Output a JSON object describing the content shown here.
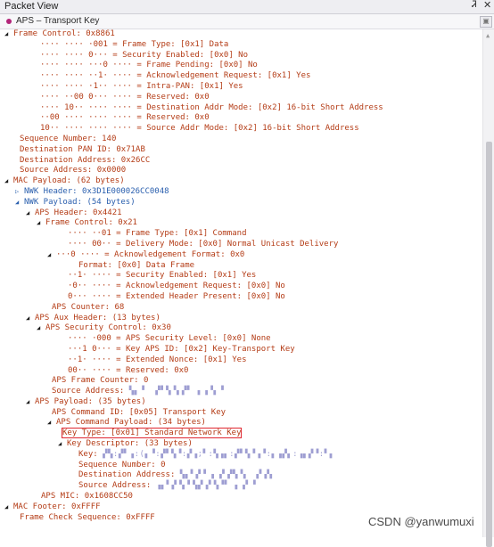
{
  "panel": {
    "title": "Packet View",
    "pin_icon": "Ꮨ",
    "close_icon": "✕",
    "tab_label": "APS – Transport Key",
    "lock_icon": "▣"
  },
  "watermark": "CSDN @yanwumuxi",
  "rows": [
    {
      "indent": 5,
      "exp": "◢",
      "text": "Frame Control: 0x8861",
      "color": "red"
    },
    {
      "indent": 45,
      "exp": "",
      "text": "···· ···· ·001 = Frame Type: [0x1] Data",
      "color": "red"
    },
    {
      "indent": 45,
      "exp": "",
      "text": "···· ···· 0··· = Security Enabled: [0x0] No",
      "color": "red"
    },
    {
      "indent": 45,
      "exp": "",
      "text": "···· ···· ···0 ···· = Frame Pending: [0x0] No",
      "color": "red"
    },
    {
      "indent": 45,
      "exp": "",
      "text": "···· ···· ··1· ···· = Acknowledgement Request: [0x1] Yes",
      "color": "red"
    },
    {
      "indent": 45,
      "exp": "",
      "text": "···· ···· ·1·· ···· = Intra-PAN: [0x1] Yes",
      "color": "red"
    },
    {
      "indent": 45,
      "exp": "",
      "text": "···· ··00 0··· ···· = Reserved: 0x0",
      "color": "red"
    },
    {
      "indent": 45,
      "exp": "",
      "text": "···· 10·· ···· ···· = Destination Addr Mode: [0x2] 16-bit Short Address",
      "color": "red"
    },
    {
      "indent": 45,
      "exp": "",
      "text": "··00 ···· ···· ···· = Reserved: 0x0",
      "color": "red"
    },
    {
      "indent": 45,
      "exp": "",
      "text": "10·· ···· ···· ···· = Source Addr Mode: [0x2] 16-bit Short Address",
      "color": "red"
    },
    {
      "indent": 22,
      "exp": "",
      "text": "Sequence Number: 140",
      "color": "red"
    },
    {
      "indent": 22,
      "exp": "",
      "text": "Destination PAN ID: 0x71AB",
      "color": "red"
    },
    {
      "indent": 22,
      "exp": "",
      "text": "Destination Address: 0x26CC",
      "color": "red"
    },
    {
      "indent": 22,
      "exp": "",
      "text": "Source Address: 0x0000",
      "color": "red"
    },
    {
      "indent": 5,
      "exp": "◢",
      "text": "MAC Payload: (62 bytes)",
      "color": "red"
    },
    {
      "indent": 17,
      "exp": "▷",
      "text": "NWK Header: 0x3D1E000026CC0048",
      "color": "blue"
    },
    {
      "indent": 17,
      "exp": "◢",
      "text": "NWK Payload: (54 bytes)",
      "color": "blue"
    },
    {
      "indent": 29,
      "exp": "◢",
      "text": "APS Header: 0x4421",
      "color": "red"
    },
    {
      "indent": 41,
      "exp": "◢",
      "text": "Frame Control: 0x21",
      "color": "red"
    },
    {
      "indent": 76,
      "exp": "",
      "text": "···· ··01 = Frame Type: [0x1] Command",
      "color": "red"
    },
    {
      "indent": 76,
      "exp": "",
      "text": "···· 00·· = Delivery Mode: [0x0] Normal Unicast Delivery",
      "color": "red"
    },
    {
      "indent": 53,
      "exp": "◢",
      "text": "···0 ···· = Acknowledgement Format: 0x0",
      "color": "red"
    },
    {
      "indent": 88,
      "exp": "",
      "text": "Format: [0x0] Data Frame",
      "color": "red"
    },
    {
      "indent": 76,
      "exp": "",
      "text": "··1· ···· = Security Enabled: [0x1] Yes",
      "color": "red"
    },
    {
      "indent": 76,
      "exp": "",
      "text": "·0·· ···· = Acknowledgement Request: [0x0] No",
      "color": "red"
    },
    {
      "indent": 76,
      "exp": "",
      "text": "0··· ···· = Extended Header Present: [0x0] No",
      "color": "red"
    },
    {
      "indent": 58,
      "exp": "",
      "text": "APS Counter: 68",
      "color": "red"
    },
    {
      "indent": 29,
      "exp": "◢",
      "text": "APS Aux Header: (13 bytes)",
      "color": "red"
    },
    {
      "indent": 41,
      "exp": "◢",
      "text": "APS Security Control: 0x30",
      "color": "red"
    },
    {
      "indent": 76,
      "exp": "",
      "text": "···· ·000 = APS Security Level: [0x0] None",
      "color": "red"
    },
    {
      "indent": 76,
      "exp": "",
      "text": "···1 0··· = Key APS ID: [0x2] Key-Transport Key",
      "color": "red"
    },
    {
      "indent": 76,
      "exp": "",
      "text": "··1· ···· = Extended Nonce: [0x1] Yes",
      "color": "red"
    },
    {
      "indent": 76,
      "exp": "",
      "text": "00·· ···· = Reserved: 0x0",
      "color": "red"
    },
    {
      "indent": 58,
      "exp": "",
      "text": "APS Frame Counter: 0",
      "color": "red"
    },
    {
      "indent": 58,
      "exp": "",
      "text": "Source Address: ",
      "color": "red",
      "redacted": "▚▖▝  ▞▘▚▝▖▞▘ ▖▗▝▖▝"
    },
    {
      "indent": 29,
      "exp": "◢",
      "text": "APS Payload: (35 bytes)",
      "color": "red"
    },
    {
      "indent": 58,
      "exp": "",
      "text": "APS Command ID: [0x05] Transport Key",
      "color": "red"
    },
    {
      "indent": 53,
      "exp": "◢",
      "text": "APS Command Payload: (34 bytes)",
      "color": "red"
    },
    {
      "indent": 70,
      "exp": "",
      "text": "Key Type: [0x01] Standard Network Key",
      "color": "red",
      "highlight": true
    },
    {
      "indent": 65,
      "exp": "◢",
      "text": "Key Descriptor: (33 bytes)",
      "color": "red"
    },
    {
      "indent": 88,
      "exp": "",
      "text": "Key: ",
      "color": "red",
      "redacted": "▞▚:▞▘▗:(▖▝:▞▘▚▝:▞▗;▘:▚▗▖:▞▘▚▝▗▝:▖▗▞▖:▗▖▞▝:▘▖"
    },
    {
      "indent": 88,
      "exp": "",
      "text": "Sequence Number: 0",
      "color": "red"
    },
    {
      "indent": 88,
      "exp": "",
      "text": "Destination Address: ",
      "color": "red",
      "redacted": "▚▖▘▞▝ ▖▗▘▞▚▝▖ ▗▘▞▖"
    },
    {
      "indent": 88,
      "exp": "",
      "text": "Source Address: ",
      "color": "red",
      "redacted": "▗▖▘▞▝▖▘▚▞▗▘▚▝▘ ▖▗▘▝"
    },
    {
      "indent": 46,
      "exp": "",
      "text": "APS MIC: 0x1608CC50",
      "color": "red"
    },
    {
      "indent": 5,
      "exp": "◢",
      "text": "MAC Footer: 0xFFFF",
      "color": "red"
    },
    {
      "indent": 22,
      "exp": "",
      "text": "Frame Check Sequence: 0xFFFF",
      "color": "red"
    }
  ]
}
